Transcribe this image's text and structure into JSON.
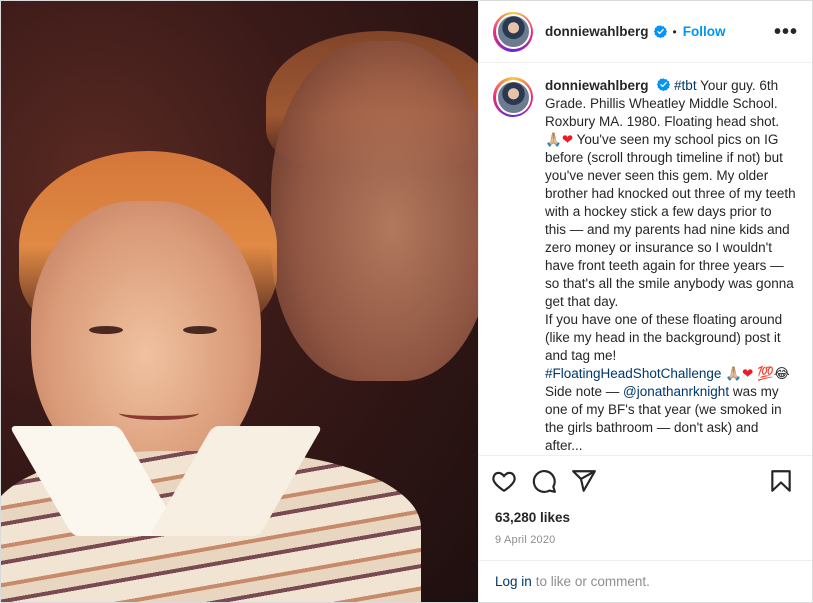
{
  "post": {
    "username": "donniewahlberg",
    "follow_label": "Follow",
    "separator": "•",
    "caption_parts": [
      {
        "kind": "tag",
        "text": "#tbt"
      },
      {
        "kind": "text",
        "text": " Your guy. 6th Grade. Phillis Wheatley Middle School. Roxbury MA. 1980. Floating head shot. "
      },
      {
        "kind": "emoji",
        "text": "🙏🏼"
      },
      {
        "kind": "heart",
        "text": "❤"
      },
      {
        "kind": "text",
        "text": " You've seen my school pics on IG before (scroll through timeline if not) but you've never seen this gem. My older brother had knocked out three of my teeth with a hockey stick a few days prior to this — and my parents had nine kids and zero money or insurance so I wouldn't have front teeth again for three years — so that's all the smile anybody was gonna get that day."
      },
      {
        "kind": "break",
        "text": ""
      },
      {
        "kind": "text",
        "text": "If you have one of these floating around (like my head in the background) post it and tag me! "
      },
      {
        "kind": "tag",
        "text": "#FloatingHeadShotChallenge"
      },
      {
        "kind": "text",
        "text": " "
      },
      {
        "kind": "emoji",
        "text": "🙏🏼"
      },
      {
        "kind": "heart",
        "text": "❤"
      },
      {
        "kind": "text",
        "text": " "
      },
      {
        "kind": "emoji",
        "text": "💯😂"
      },
      {
        "kind": "text",
        "text": " Side note — "
      },
      {
        "kind": "tag",
        "text": "@jonathanrknight"
      },
      {
        "kind": "text",
        "text": " was my one of my BF's that year (we smoked in the girls bathroom — don't ask) and after..."
      }
    ],
    "likes": "63,280 likes",
    "date": "9 April 2020",
    "login_link": "Log in",
    "login_rest": "to like or comment."
  },
  "icons": [
    "verified-badge-icon",
    "more-options-icon",
    "heart-icon",
    "comment-icon",
    "share-icon",
    "bookmark-icon"
  ],
  "colors": {
    "accent": "#0095f6",
    "tag": "#00376b",
    "muted": "#8e8e8e",
    "heart": "#ed1c24",
    "text": "#262626"
  }
}
